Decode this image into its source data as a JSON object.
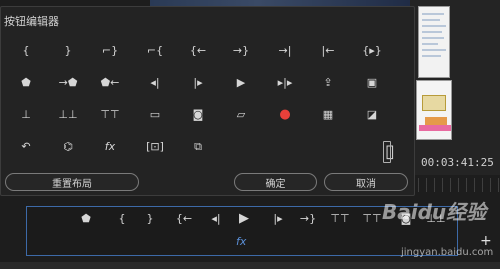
{
  "dialog": {
    "title": "按钮编辑器",
    "reset_label": "重置布局",
    "ok_label": "确定",
    "cancel_label": "取消"
  },
  "grid_icons": [
    {
      "name": "mark-in-icon",
      "glyph": "{"
    },
    {
      "name": "mark-out-icon",
      "glyph": "}"
    },
    {
      "name": "mark-clip-end-icon",
      "glyph": "⌐}"
    },
    {
      "name": "mark-clip-icon",
      "glyph": "⌐{"
    },
    {
      "name": "go-to-in-icon",
      "glyph": "{←"
    },
    {
      "name": "go-to-out-icon",
      "glyph": "→}"
    },
    {
      "name": "go-to-next-edit-icon",
      "glyph": "→|"
    },
    {
      "name": "go-to-prev-edit-icon",
      "glyph": "|←"
    },
    {
      "name": "play-in-to-out-icon",
      "glyph": "{▸}"
    },
    {
      "name": "add-marker-icon",
      "glyph": "⬟"
    },
    {
      "name": "next-marker-icon",
      "glyph": "→⬟"
    },
    {
      "name": "prev-marker-icon",
      "glyph": "⬟←"
    },
    {
      "name": "step-back-icon",
      "glyph": "◂|"
    },
    {
      "name": "step-forward-icon",
      "glyph": "|▸"
    },
    {
      "name": "play-icon",
      "glyph": "▶"
    },
    {
      "name": "play-around-icon",
      "glyph": "▸|▸"
    },
    {
      "name": "export-frame-icon",
      "glyph": "⇪"
    },
    {
      "name": "overwrite-icon",
      "glyph": "▣"
    },
    {
      "name": "lift-icon",
      "glyph": "⊥"
    },
    {
      "name": "extract-icon",
      "glyph": "⊥⊥"
    },
    {
      "name": "insert-icon",
      "glyph": "⊤⊤"
    },
    {
      "name": "safe-margins-icon",
      "glyph": "▭"
    },
    {
      "name": "camera-icon",
      "glyph": "◙"
    },
    {
      "name": "comment-icon",
      "glyph": "▱"
    },
    {
      "name": "record-icon",
      "glyph": "●"
    },
    {
      "name": "multi-camera-icon",
      "glyph": "▦"
    },
    {
      "name": "comparison-view-icon",
      "glyph": "◪"
    },
    {
      "name": "loop-icon",
      "glyph": "↶"
    },
    {
      "name": "vr-icon",
      "glyph": "⌬"
    },
    {
      "name": "fx-icon",
      "glyph": "fx"
    },
    {
      "name": "trim-icon",
      "glyph": "[⊡]"
    },
    {
      "name": "proxy-toggle-icon",
      "glyph": "⧉"
    },
    {
      "name": "spacer-icon",
      "glyph": "▯"
    }
  ],
  "transport_icons": [
    {
      "name": "add-marker-icon",
      "glyph": "⬟"
    },
    {
      "name": "mark-in-icon",
      "glyph": "{"
    },
    {
      "name": "mark-out-icon",
      "glyph": "}"
    },
    {
      "name": "go-to-in-icon",
      "glyph": "{←"
    },
    {
      "name": "step-back-icon",
      "glyph": "◂|"
    },
    {
      "name": "play-icon",
      "glyph": "▶"
    },
    {
      "name": "step-forward-icon",
      "glyph": "|▸"
    },
    {
      "name": "go-to-out-icon",
      "glyph": "→}"
    },
    {
      "name": "insert-icon",
      "glyph": "⊤⊤"
    },
    {
      "name": "overwrite-icon",
      "glyph": "⊤⊤"
    },
    {
      "name": "camera-icon",
      "glyph": "◙"
    },
    {
      "name": "extract-icon",
      "glyph": "⊥⊥"
    }
  ],
  "transport_fx": "fx",
  "timecode": "00:03:41:25",
  "watermark": {
    "logo": "Baidu经验",
    "site": "jingyan.baidu.com"
  },
  "plus_label": "+",
  "colors": {
    "record": "#e8403a",
    "transport_border": "#3d6aa8"
  }
}
